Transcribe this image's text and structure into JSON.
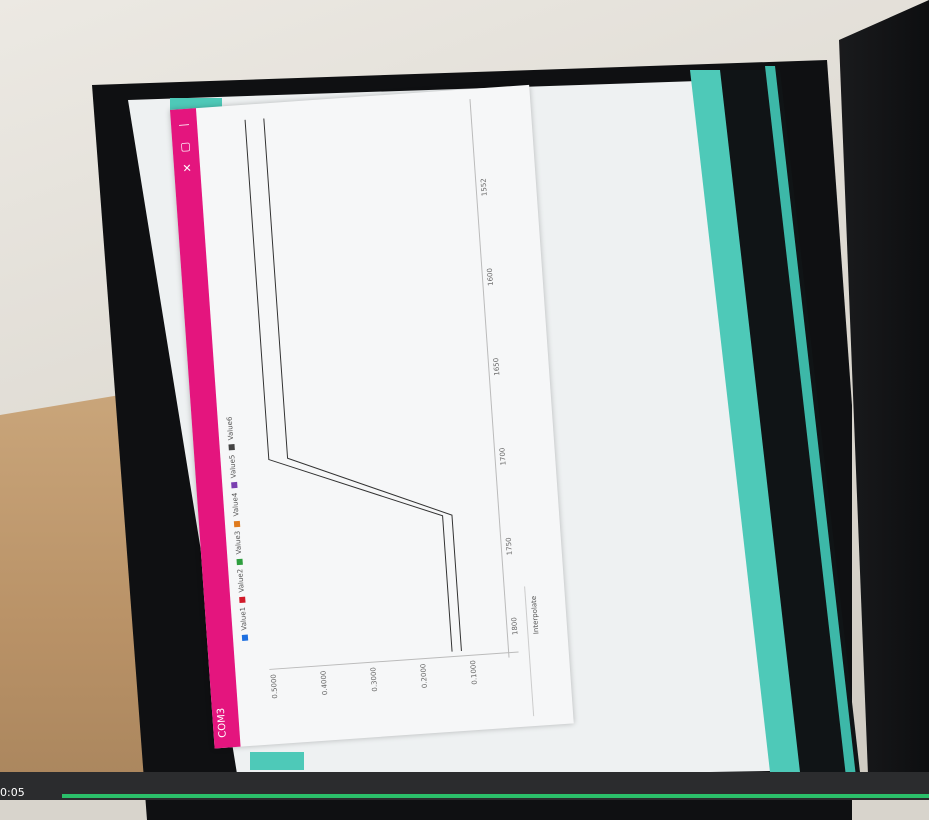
{
  "window": {
    "title": "COM3",
    "controls": [
      "—",
      "▢",
      "✕"
    ]
  },
  "legend": {
    "entries": [
      "Value1",
      "Value2",
      "Value3",
      "Value4",
      "Value5",
      "Value6"
    ],
    "colors": [
      "#1e6fe0",
      "#d11a2a",
      "#2e9e3e",
      "#e07b1e",
      "#7a3fb0",
      "#444444"
    ]
  },
  "plot": {
    "y_ticks": [
      "0.5000",
      "0.4000",
      "0.3000",
      "0.2000",
      "0.1000"
    ],
    "x_ticks": [
      "1552",
      "1600",
      "1650",
      "1700",
      "1750",
      "1800"
    ],
    "interpolate_label": "Interpolate"
  },
  "chart_data": {
    "type": "line",
    "series": [
      {
        "values": [
          0.48,
          0.48,
          0.48,
          0.48,
          0.48,
          0.48,
          0.12,
          0.12,
          0.12
        ]
      },
      {
        "values": [
          0.44,
          0.44,
          0.44,
          0.44,
          0.44,
          0.44,
          0.1,
          0.1,
          0.1
        ]
      }
    ]
  },
  "video": {
    "time": "0:05",
    "progress": 1.0
  }
}
